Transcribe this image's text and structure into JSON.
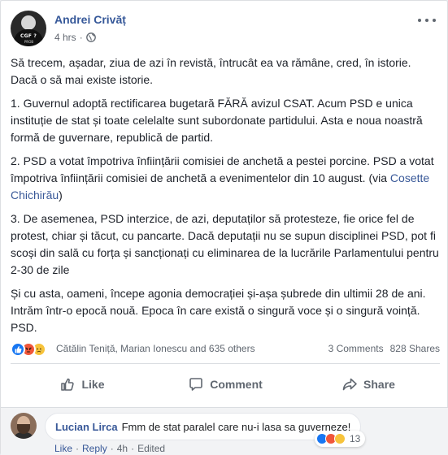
{
  "post": {
    "author": "Andrei Crivăț",
    "time": "4 hrs",
    "separator": "·",
    "avatar_shirt_text": "CGF ?",
    "avatar_shirt_sub": "PROB",
    "privacy_icon": "globe-icon",
    "paragraphs": [
      "Să trecem, așadar, ziua de azi în revistă, întrucât ea va rămâne, cred, în istorie. Dacă o să mai existe istorie.",
      "1. Guvernul adoptă rectificarea bugetară FĂRĂ avizul CSAT. Acum PSD e unica instituție de stat și toate celelalte sunt subordonate partidului. Asta e noua noastră formă de guvernare, republică de partid.",
      "2. PSD a votat împotriva înființării comisiei de anchetă a pestei porcine. PSD a votat împotriva înființării comisiei de anchetă a evenimentelor din 10 august. (via ",
      "3. De asemenea, PSD interzice, de azi, deputaților să protesteze, fie orice fel de protest, chiar și tăcut, cu pancarte. Dacă deputații nu se supun disciplinei PSD, pot fi scoși din sală cu forța și sancționați cu eliminarea de la lucrările Parlamentului pentru 2-30 de zile",
      "Și cu asta, oameni, începe agonia democrației și-așa șubrede din ultimii 28 de ani. Intrăm într-o epocă nouă. Epoca în care există o singură voce și o singură voință. PSD."
    ],
    "link_name": "Cosette Chichirău",
    "link_suffix": ")"
  },
  "reactions": {
    "icons": [
      "like-icon",
      "angry-icon",
      "sad-icon"
    ],
    "names": "Cătălin Teniță, Marian Ionescu and 635 others",
    "comments": "3 Comments",
    "shares": "828 Shares"
  },
  "actions": {
    "like": "Like",
    "comment": "Comment",
    "share": "Share"
  },
  "comment": {
    "author": "Lucian Lirca",
    "text": "Fmm de stat paralel care nu-i lasa sa guverneze!",
    "reaction_count": "13",
    "like": "Like",
    "reply": "Reply",
    "time": "4h",
    "edited": "Edited",
    "separator": "·"
  },
  "colors": {
    "link": "#385898",
    "author": "#365899",
    "like_blue": "#1877f2",
    "angry": "#f0563a",
    "sad": "#f7c33b"
  }
}
